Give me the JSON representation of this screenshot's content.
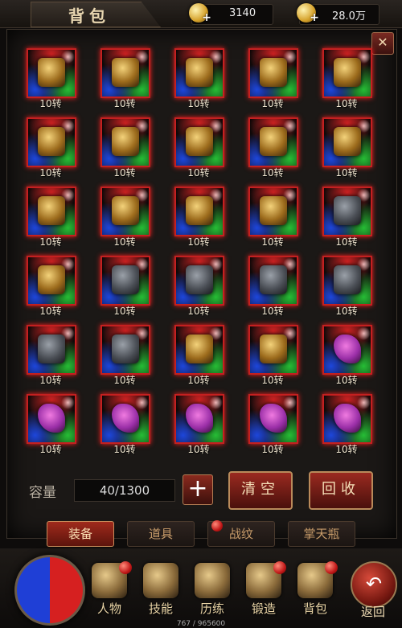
{
  "header": {
    "title": "背包",
    "currencies": [
      {
        "icon": "gold-coin-plus-icon",
        "value": "3140"
      },
      {
        "icon": "gold-ingot-plus-icon",
        "value": "28.0万"
      }
    ]
  },
  "grid": {
    "rows": [
      [
        "10转",
        "10转",
        "10转",
        "10转",
        "10转"
      ],
      [
        "10转",
        "10转",
        "10转",
        "10转",
        "10转"
      ],
      [
        "10转",
        "10转",
        "10转",
        "10转",
        "10转"
      ],
      [
        "10转",
        "10转",
        "10转",
        "10转",
        "10转"
      ],
      [
        "10转",
        "10转",
        "10转",
        "10转",
        "10转"
      ],
      [
        "10转",
        "10转",
        "10转",
        "10转",
        "10转"
      ]
    ]
  },
  "capacity": {
    "label": "容量",
    "value": "40/1300",
    "add_label": "+"
  },
  "actions": {
    "clear": "清空",
    "recycle": "回收"
  },
  "tabs": [
    {
      "label": "装备",
      "active": true
    },
    {
      "label": "道具",
      "active": false
    },
    {
      "label": "战纹",
      "active": false
    },
    {
      "label": "掌天瓶",
      "active": false
    }
  ],
  "dock": {
    "items": [
      {
        "label": "人物",
        "badge": true
      },
      {
        "label": "技能",
        "badge": false
      },
      {
        "label": "历练",
        "badge": false
      },
      {
        "label": "锻造",
        "badge": true
      },
      {
        "label": "背包",
        "badge": true
      }
    ],
    "back_label": "返回"
  },
  "exp_text": "767 / 965600"
}
